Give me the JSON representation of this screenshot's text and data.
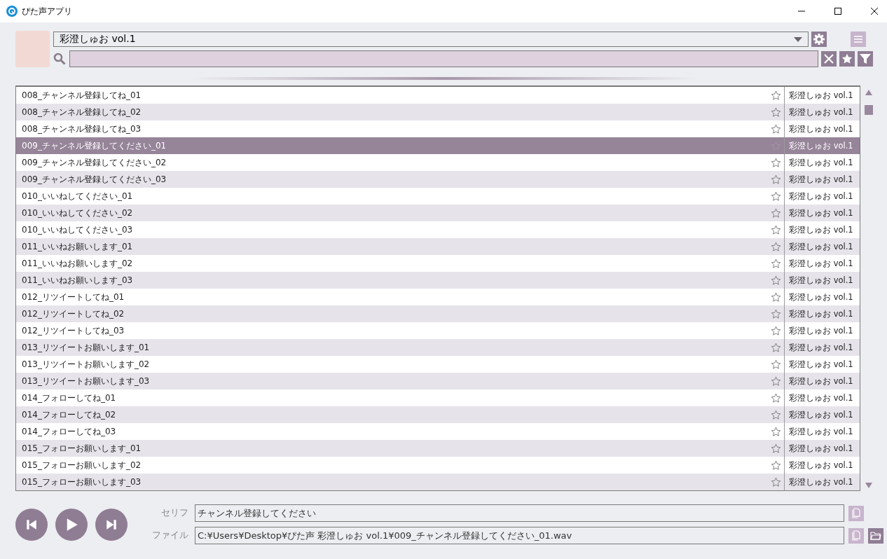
{
  "window": {
    "title": "ぴた声アプリ"
  },
  "voice_select": {
    "value": "彩澄しゅお vol.1"
  },
  "list": {
    "rows": [
      {
        "name": "008_チャンネル登録してね_01",
        "starred": false,
        "source": "彩澄しゅお vol.1",
        "selected": false
      },
      {
        "name": "008_チャンネル登録してね_02",
        "starred": false,
        "source": "彩澄しゅお vol.1",
        "selected": false
      },
      {
        "name": "008_チャンネル登録してね_03",
        "starred": false,
        "source": "彩澄しゅお vol.1",
        "selected": false
      },
      {
        "name": "009_チャンネル登録してください_01",
        "starred": false,
        "source": "彩澄しゅお vol.1",
        "selected": true
      },
      {
        "name": "009_チャンネル登録してください_02",
        "starred": false,
        "source": "彩澄しゅお vol.1",
        "selected": false
      },
      {
        "name": "009_チャンネル登録してください_03",
        "starred": false,
        "source": "彩澄しゅお vol.1",
        "selected": false
      },
      {
        "name": "010_いいねしてください_01",
        "starred": false,
        "source": "彩澄しゅお vol.1",
        "selected": false
      },
      {
        "name": "010_いいねしてください_02",
        "starred": false,
        "source": "彩澄しゅお vol.1",
        "selected": false
      },
      {
        "name": "010_いいねしてください_03",
        "starred": false,
        "source": "彩澄しゅお vol.1",
        "selected": false
      },
      {
        "name": "011_いいねお願いします_01",
        "starred": false,
        "source": "彩澄しゅお vol.1",
        "selected": false
      },
      {
        "name": "011_いいねお願いします_02",
        "starred": false,
        "source": "彩澄しゅお vol.1",
        "selected": false
      },
      {
        "name": "011_いいねお願いします_03",
        "starred": false,
        "source": "彩澄しゅお vol.1",
        "selected": false
      },
      {
        "name": "012_リツイートしてね_01",
        "starred": false,
        "source": "彩澄しゅお vol.1",
        "selected": false
      },
      {
        "name": "012_リツイートしてね_02",
        "starred": false,
        "source": "彩澄しゅお vol.1",
        "selected": false
      },
      {
        "name": "012_リツイートしてね_03",
        "starred": false,
        "source": "彩澄しゅお vol.1",
        "selected": false
      },
      {
        "name": "013_リツイートお願いします_01",
        "starred": false,
        "source": "彩澄しゅお vol.1",
        "selected": false
      },
      {
        "name": "013_リツイートお願いします_02",
        "starred": false,
        "source": "彩澄しゅお vol.1",
        "selected": false
      },
      {
        "name": "013_リツイートお願いします_03",
        "starred": false,
        "source": "彩澄しゅお vol.1",
        "selected": false
      },
      {
        "name": "014_フォローしてね_01",
        "starred": false,
        "source": "彩澄しゅお vol.1",
        "selected": false
      },
      {
        "name": "014_フォローしてね_02",
        "starred": false,
        "source": "彩澄しゅお vol.1",
        "selected": false
      },
      {
        "name": "014_フォローしてね_03",
        "starred": false,
        "source": "彩澄しゅお vol.1",
        "selected": false
      },
      {
        "name": "015_フォローお願いします_01",
        "starred": false,
        "source": "彩澄しゅお vol.1",
        "selected": false
      },
      {
        "name": "015_フォローお願いします_02",
        "starred": false,
        "source": "彩澄しゅお vol.1",
        "selected": false
      },
      {
        "name": "015_フォローお願いします_03",
        "starred": false,
        "source": "彩澄しゅお vol.1",
        "selected": false
      }
    ]
  },
  "details": [
    {
      "label": "セリフ",
      "value": "チャンネル登録してください",
      "folder_button": false
    },
    {
      "label": "ファイル",
      "value": "C:¥Users¥Desktop¥ぴた声 彩澄しゅお vol.1¥009_チャンネル登録してください_01.wav",
      "folder_button": true
    }
  ]
}
